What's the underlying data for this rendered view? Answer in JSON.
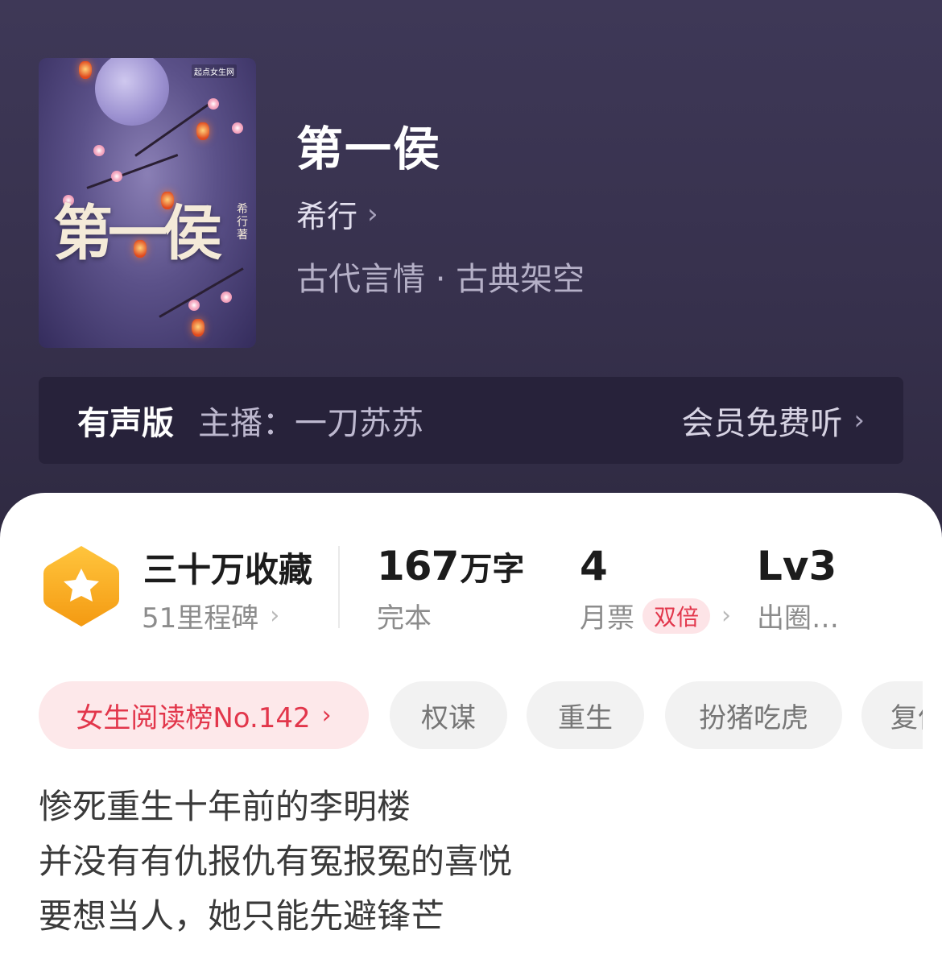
{
  "book": {
    "title": "第一侯",
    "author": "希行",
    "genre": "古代言情 · 古典架空",
    "cover": {
      "title_art": "第一侯",
      "author_art": "希行著",
      "publisher_logo": "起点女生网"
    }
  },
  "audio": {
    "label": "有声版",
    "host": "主播：一刀苏苏",
    "cta": "会员免费听"
  },
  "stats": {
    "collection": {
      "main": "三十万收藏",
      "sub": "51里程碑"
    },
    "words": {
      "number": "167",
      "unit": "万字",
      "status": "完本"
    },
    "tickets": {
      "count": "4",
      "label": "月票",
      "badge": "双倍"
    },
    "level": {
      "main": "Lv3",
      "sub": "出圈…"
    }
  },
  "tags": [
    {
      "label": "女生阅读榜No.142"
    },
    {
      "label": "权谋"
    },
    {
      "label": "重生"
    },
    {
      "label": "扮猪吃虎"
    },
    {
      "label": "复仇"
    }
  ],
  "synopsis": [
    "惨死重生十年前的李明楼",
    "并没有有仇报仇有冤报冤的喜悦",
    "要想当人，她只能先避锋芒"
  ],
  "icons": {
    "chevron": "chevron-right-icon",
    "badge": "star-hexagon-icon"
  },
  "colors": {
    "hero_bg": "#3a3450",
    "audio_bar_bg": "#27223a",
    "accent_red": "#e2364b",
    "badge_orange": "#f7a21b"
  }
}
